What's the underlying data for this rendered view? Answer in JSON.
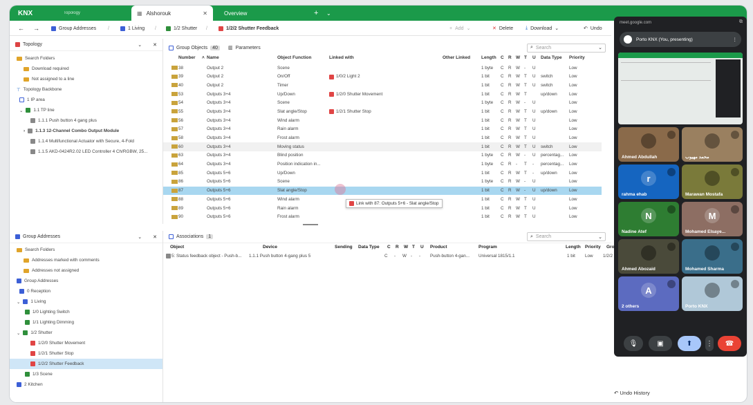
{
  "tabs": {
    "logo": "KNX",
    "topology_tab": "Topology",
    "active_tab": "Alshorouk",
    "overview_tab": "Overview"
  },
  "toolbar": {
    "breadcrumb": [
      "Group Addresses",
      "1 Living",
      "1/2 Shutter",
      "1/2/2 Shutter Feedback"
    ],
    "add": "Add",
    "delete": "Delete",
    "download": "Download",
    "undo": "Undo"
  },
  "topology": {
    "title": "Topology",
    "items": [
      {
        "label": "Search Folders",
        "icon": "folder"
      },
      {
        "label": "Download required",
        "icon": "folder"
      },
      {
        "label": "Not assigned to a line",
        "icon": "folder"
      },
      {
        "label": "Topology Backbone",
        "icon": "backbone"
      },
      {
        "label": "1 IP area",
        "icon": "area"
      },
      {
        "label": "1.1 TP line",
        "icon": "line"
      },
      {
        "label": "1.1.1 Push button 4 gang plus",
        "icon": "device"
      },
      {
        "label": "1.1.3 12-Channel Combo Output Module",
        "icon": "device"
      },
      {
        "label": "1.1.4 Multifunctional Actuator with Secure, 4-Fold",
        "icon": "device"
      },
      {
        "label": "1.1.5 AKD-0424R2.02 LED Controller 4 Ch/RGBW, 25...",
        "icon": "device"
      }
    ]
  },
  "group_objects": {
    "tab": "Group Objects",
    "count": "40",
    "params_tab": "Parameters",
    "search_placeholder": "Search",
    "columns": [
      "Number",
      "Name",
      "Object Function",
      "Linked with",
      "Other Linked",
      "Length",
      "C",
      "R",
      "W",
      "T",
      "U",
      "Data Type",
      "Priority"
    ],
    "rows": [
      [
        "38",
        "Output 2",
        "Scene",
        "",
        "1 byte",
        "C",
        "R",
        "W",
        "-",
        "U",
        "",
        "Low"
      ],
      [
        "39",
        "Output 2",
        "On/Off",
        "1/0/2 Light 2",
        "1 bit",
        "C",
        "R",
        "W",
        "T",
        "U",
        "switch",
        "Low"
      ],
      [
        "40",
        "Output 2",
        "Timer",
        "",
        "1 bit",
        "C",
        "R",
        "W",
        "T",
        "U",
        "switch",
        "Low"
      ],
      [
        "53",
        "Outputs 3+4",
        "Up/Down",
        "1/2/0 Shutter Movement",
        "1 bit",
        "C",
        "R",
        "W",
        "T",
        "",
        "up/down",
        "Low"
      ],
      [
        "54",
        "Outputs 3+4",
        "Scene",
        "",
        "1 byte",
        "C",
        "R",
        "W",
        "-",
        "U",
        "",
        "Low"
      ],
      [
        "55",
        "Outputs 3+4",
        "Slat angle/Stop",
        "1/2/1 Shutter Stop",
        "1 bit",
        "C",
        "R",
        "W",
        "T",
        "U",
        "up/down",
        "Low"
      ],
      [
        "56",
        "Outputs 3+4",
        "Wind alarm",
        "",
        "1 bit",
        "C",
        "R",
        "W",
        "T",
        "U",
        "",
        "Low"
      ],
      [
        "57",
        "Outputs 3+4",
        "Rain alarm",
        "",
        "1 bit",
        "C",
        "R",
        "W",
        "T",
        "U",
        "",
        "Low"
      ],
      [
        "58",
        "Outputs 3+4",
        "Frost alarm",
        "",
        "1 bit",
        "C",
        "R",
        "W",
        "T",
        "U",
        "",
        "Low"
      ],
      [
        "60",
        "Outputs 3+4",
        "Moving status",
        "",
        "1 bit",
        "C",
        "R",
        "W",
        "T",
        "U",
        "switch",
        "Low"
      ],
      [
        "63",
        "Outputs 3+4",
        "Blind position",
        "",
        "1 byte",
        "C",
        "R",
        "W",
        "-",
        "U",
        "percentag...",
        "Low"
      ],
      [
        "64",
        "Outputs 3+4",
        "Position indication in...",
        "",
        "1 byte",
        "C",
        "R",
        "-",
        "T",
        "-",
        "percentag...",
        "Low"
      ],
      [
        "85",
        "Outputs 5+6",
        "Up/Down",
        "",
        "1 bit",
        "C",
        "R",
        "W",
        "T",
        "-",
        "up/down",
        "Low"
      ],
      [
        "86",
        "Outputs 5+6",
        "Scene",
        "",
        "1 byte",
        "C",
        "R",
        "W",
        "-",
        "U",
        "",
        "Low"
      ],
      [
        "87",
        "Outputs 5+6",
        "Slat angle/Stop",
        "",
        "1 bit",
        "C",
        "R",
        "W",
        "-",
        "U",
        "up/down",
        "Low"
      ],
      [
        "88",
        "Outputs 5+6",
        "Wind alarm",
        "",
        "1 bit",
        "C",
        "R",
        "W",
        "T",
        "U",
        "",
        "Low"
      ],
      [
        "89",
        "Outputs 5+6",
        "Rain alarm",
        "",
        "1 bit",
        "C",
        "R",
        "W",
        "T",
        "U",
        "",
        "Low"
      ],
      [
        "90",
        "Outputs 5+6",
        "Frost alarm",
        "",
        "1 bit",
        "C",
        "R",
        "W",
        "T",
        "U",
        "",
        "Low"
      ]
    ],
    "drag_tooltip": "Link with 87: Outputs 5+6 - Slat angle/Stop"
  },
  "group_addresses": {
    "title": "Group Addresses",
    "items": [
      {
        "label": "Search Folders",
        "icon": "folder"
      },
      {
        "label": "Addresses marked with comments",
        "icon": "folder"
      },
      {
        "label": "Addresses not assigned",
        "icon": "folder"
      },
      {
        "label": "Group Addresses",
        "icon": "ga"
      },
      {
        "label": "0 Reception",
        "icon": "main"
      },
      {
        "label": "1 Living",
        "icon": "main"
      },
      {
        "label": "1/0 Lighting Switch",
        "icon": "middle"
      },
      {
        "label": "1/1 Lighting Dimming",
        "icon": "middle"
      },
      {
        "label": "1/2 Shutter",
        "icon": "middle"
      },
      {
        "label": "1/2/0 Shutter Movement",
        "icon": "ga-red"
      },
      {
        "label": "1/2/1 Shutter Stop",
        "icon": "ga-red"
      },
      {
        "label": "1/2/2 Shutter Feedback",
        "icon": "ga-red"
      },
      {
        "label": "1/3 Scene",
        "icon": "middle"
      },
      {
        "label": "2 Kitchen",
        "icon": "main"
      }
    ]
  },
  "associations": {
    "tab": "Associations",
    "count": "1",
    "search_placeholder": "Search",
    "columns": [
      "Object",
      "Device",
      "Sending",
      "Data Type",
      "C",
      "R",
      "W",
      "T",
      "U",
      "Product",
      "Program",
      "Length",
      "Priority",
      "Grou"
    ],
    "row": [
      "5: Status feedback object - Push-b...",
      "1.1.1 Push button 4-gang plus 5",
      "",
      "",
      "C",
      "-",
      "W",
      "-",
      "-",
      "Push-button 4-gan...",
      "Universal 1815/1.1",
      "1 bit",
      "Low",
      "1/2/2"
    ]
  },
  "meet": {
    "url": "meet.google.com",
    "presenter": "Porto KNX (You, presenting)",
    "participants": [
      {
        "name": "Ahmed Abdullah",
        "color": "#8a6a4a"
      },
      {
        "name": "محمد مهيوب",
        "color": "#9a8060"
      },
      {
        "name": "rahma ehab",
        "letter": "r",
        "color": "#1565c0"
      },
      {
        "name": "Marawan Mostafa",
        "color": "#7a7a3a"
      },
      {
        "name": "Nadine Atef",
        "letter": "N",
        "color": "#2e7d32"
      },
      {
        "name": "Mohamed Elsaye...",
        "letter": "M",
        "color": "#8d6e63"
      },
      {
        "name": "Ahmed Abozaid",
        "color": "#4a4a3a"
      },
      {
        "name": "Mohamed Sharma",
        "color": "#3a6e8a"
      },
      {
        "name": "2 others",
        "letter": "A",
        "color": "#5c6bc0"
      },
      {
        "name": "Porto KNX",
        "color": "#b0c8d8"
      }
    ]
  },
  "undo_history": "Undo History"
}
